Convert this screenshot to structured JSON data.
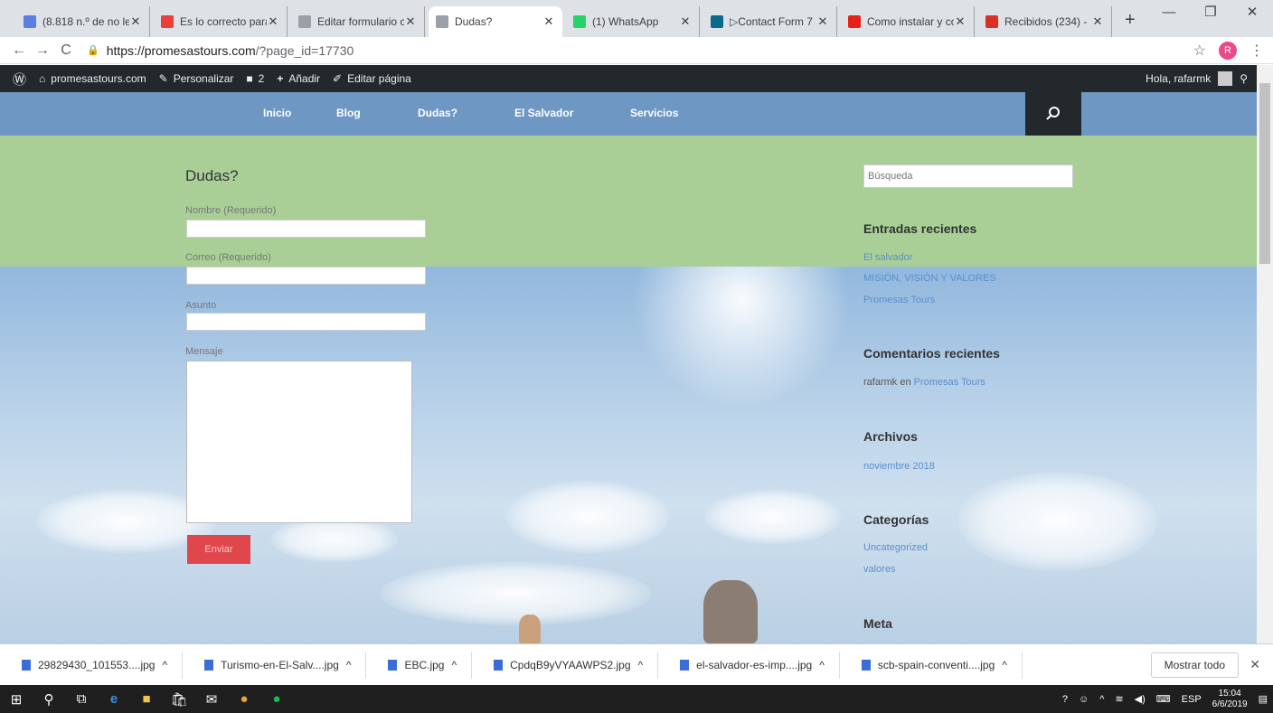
{
  "browser": {
    "tabs": [
      {
        "title": "(8.818 n.º de no le",
        "color": "#5b7fe0"
      },
      {
        "title": "Es lo correcto para",
        "color": "#e8413a"
      },
      {
        "title": "Editar formulario c",
        "color": "#9aa0a6"
      },
      {
        "title": "Dudas?",
        "color": "#9aa0a6"
      },
      {
        "title": "(1) WhatsApp",
        "color": "#25d366"
      },
      {
        "title": "▷Contact Form 7",
        "color": "#0b6a8c"
      },
      {
        "title": "Como instalar y co",
        "color": "#e62117"
      },
      {
        "title": "Recibidos (234) -",
        "color": "#d93025"
      }
    ],
    "active_tab_index": 3,
    "url_host": "https://promesastours.com",
    "url_path": "/?page_id=17730",
    "profile_initial": "R"
  },
  "wp_admin": {
    "site": "promesastours.com",
    "customize": "Personalizar",
    "comments": "2",
    "add": "Añadir",
    "edit": "Editar página",
    "greeting": "Hola, rafarmk"
  },
  "nav": {
    "items": [
      "Inicio",
      "Blog",
      "Dudas?",
      "El Salvador",
      "Servicios"
    ]
  },
  "form": {
    "title": "Dudas?",
    "name_label": "Nombre (Requerido)",
    "email_label": "Correo (Requerido)",
    "subject_label": "Asunto",
    "message_label": "Mensaje",
    "submit_label": "Enviar"
  },
  "sidebar": {
    "search_placeholder": "Búsqueda",
    "recent_posts_title": "Entradas recientes",
    "recent_posts": [
      "El salvador",
      "MISIÓN, VISIÓN Y VALORES",
      "Promesas Tours"
    ],
    "recent_comments_title": "Comentarios recientes",
    "comment_author": "rafarmk en",
    "comment_post": "Promesas Tours",
    "archives_title": "Archivos",
    "archives": [
      "noviembre 2018"
    ],
    "categories_title": "Categorías",
    "categories": [
      "Uncategorized",
      "valores"
    ],
    "meta_title": "Meta"
  },
  "downloads": {
    "files": [
      "29829430_101553....jpg",
      "Turismo-en-El-Salv....jpg",
      "EBC.jpg",
      "CpdqB9yVYAAWPS2.jpg",
      "el-salvador-es-imp....jpg",
      "scb-spain-conventi....jpg"
    ],
    "show_all": "Mostrar todo"
  },
  "taskbar": {
    "lang": "ESP",
    "time": "15:04",
    "date": "6/6/2019"
  }
}
